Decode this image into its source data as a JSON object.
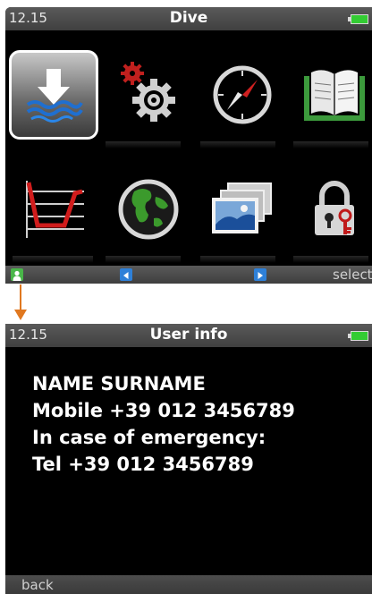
{
  "dive_screen": {
    "status": {
      "time": "12.15",
      "title": "Dive"
    },
    "menu_icons": [
      "dive-mode-icon",
      "settings-gears-icon",
      "compass-icon",
      "logbook-icon",
      "dive-profile-icon",
      "globe-icon",
      "gallery-icon",
      "lock-icon"
    ],
    "softkeys": {
      "select_label": "select"
    }
  },
  "user_info_screen": {
    "status": {
      "time": "12.15",
      "title": "User info"
    },
    "lines": [
      "NAME SURNAME",
      "Mobile +39 012 3456789",
      "In case of emergency:",
      "Tel +39 012 3456789"
    ],
    "softkeys": {
      "back_label": "back"
    }
  },
  "colors": {
    "battery": "#33cc33",
    "arrow": "#e07820",
    "softkey_green": "#49b649",
    "softkey_blue": "#2e80d8"
  }
}
